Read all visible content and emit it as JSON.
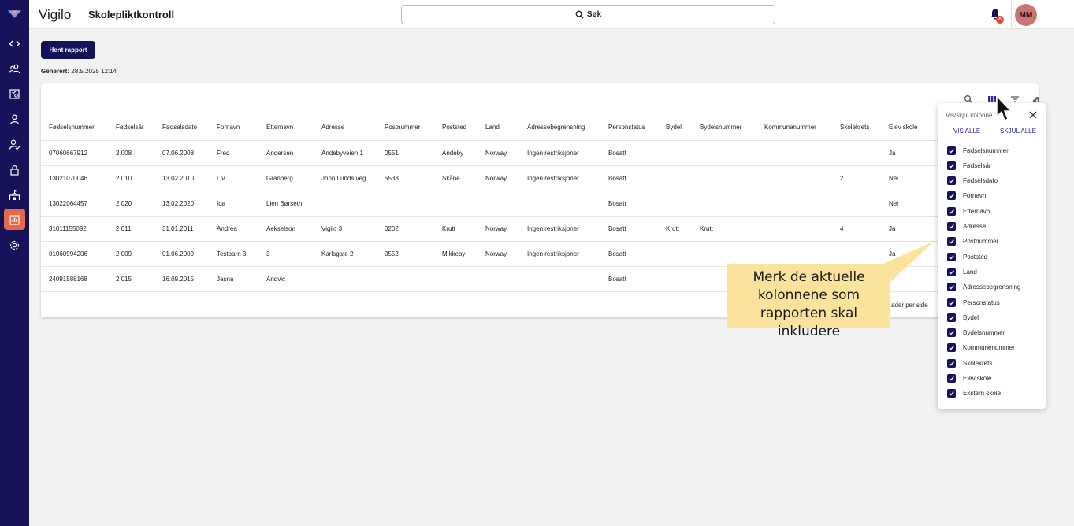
{
  "app": {
    "brand": "Vigilo",
    "page_title": "Skolepliktkontroll"
  },
  "colors": {
    "primary": "#14135a",
    "accent": "#e8684a",
    "callout": "#fbe39c",
    "avatar": "#c97574",
    "badge": "#e8452c"
  },
  "sidebar": {
    "items": [
      {
        "icon": "code-icon",
        "active": false
      },
      {
        "icon": "users-icon",
        "active": false
      },
      {
        "icon": "task-icon",
        "active": false
      },
      {
        "icon": "person-icon",
        "active": false
      },
      {
        "icon": "person-check-icon",
        "active": false
      },
      {
        "icon": "lock-icon",
        "active": false
      },
      {
        "icon": "school-icon",
        "active": false
      },
      {
        "icon": "bar-chart-icon",
        "active": true
      },
      {
        "icon": "gear-icon",
        "active": false
      }
    ]
  },
  "header": {
    "search_label": "Søk",
    "notification_count": "99",
    "avatar_initials": "MM"
  },
  "toolbar": {
    "fetch_label": "Hent rapport",
    "generated_label": "Generert:",
    "generated_value": "28.5.2025 12:14"
  },
  "table": {
    "columns": [
      "Fødselsnummer",
      "Fødselsår",
      "Fødselsdato",
      "Fornavn",
      "Etternavn",
      "Adresse",
      "Postnummer",
      "Poststed",
      "Land",
      "Adressebegrensning",
      "Personstatus",
      "Bydel",
      "Bydelsnummer",
      "Kommunenummer",
      "Skolekrets",
      "Elev skole"
    ],
    "rows": [
      [
        "07060667912",
        "2 008",
        "07.06.2008",
        "Fred",
        "Andersen",
        "Andebyveien 1",
        "0551",
        "Andeby",
        "Norway",
        "Ingen restriksjoner",
        "Bosatt",
        "",
        "",
        "",
        "",
        "Ja"
      ],
      [
        "13021070046",
        "2 010",
        "13.02.2010",
        "Liv",
        "Granberg",
        "John Lunds veg",
        "5533",
        "Skåne",
        "Norway",
        "Ingen restriksjoner",
        "Bosatt",
        "",
        "",
        "",
        "2",
        "Nei"
      ],
      [
        "13022064457",
        "2 020",
        "13.02.2020",
        "Ida",
        "Lien Børseth",
        "",
        "",
        "",
        "",
        "",
        "Bosatt",
        "",
        "",
        "",
        "",
        "Nei"
      ],
      [
        "31011155092",
        "2 011",
        "31.01.2011",
        "Andrea",
        "Aekselson",
        "Vigilo 3",
        "0202",
        "Krutt",
        "Norway",
        "Ingen restriksjoner",
        "Bosatt",
        "Krutt",
        "Krutt",
        "",
        "4",
        "Ja"
      ],
      [
        "01060994206",
        "2 009",
        "01.06.2009",
        "Testbarn 3",
        "3",
        "Karlsgate 2",
        "0552",
        "Mikkeby",
        "Norway",
        "Ingen restriksjoner",
        "Bosatt",
        "",
        "",
        "",
        "",
        "Ja"
      ],
      [
        "24091588168",
        "2 015",
        "16.09.2015",
        "Jasna",
        "Andvic",
        "",
        "",
        "",
        "",
        "",
        "Bosatt",
        "",
        "",
        "",
        "",
        ""
      ]
    ],
    "rows_per_page_label": "ader per side"
  },
  "column_picker": {
    "title": "Vis/skjul kolonne",
    "show_all": "VIS ALLE",
    "hide_all": "SKJUL ALLE",
    "options": [
      {
        "label": "Fødselsnummer",
        "checked": true
      },
      {
        "label": "Fødselsår",
        "checked": true
      },
      {
        "label": "Fødselsdato",
        "checked": true
      },
      {
        "label": "Fornavn",
        "checked": true
      },
      {
        "label": "Etternavn",
        "checked": true
      },
      {
        "label": "Adresse",
        "checked": true
      },
      {
        "label": "Postnummer",
        "checked": true
      },
      {
        "label": "Poststed",
        "checked": true
      },
      {
        "label": "Land",
        "checked": true
      },
      {
        "label": "Adressebegrensning",
        "checked": true
      },
      {
        "label": "Personstatus",
        "checked": true
      },
      {
        "label": "Bydel",
        "checked": true
      },
      {
        "label": "Bydelsnummer",
        "checked": true
      },
      {
        "label": "Kommunenummer",
        "checked": true
      },
      {
        "label": "Skolekrets",
        "checked": true
      },
      {
        "label": "Elev skole",
        "checked": true
      },
      {
        "label": "Ekstern skole",
        "checked": true
      }
    ]
  },
  "callout": {
    "lines": [
      "Merk de aktuelle",
      "kolonnene som",
      "rapporten skal inkludere"
    ]
  }
}
